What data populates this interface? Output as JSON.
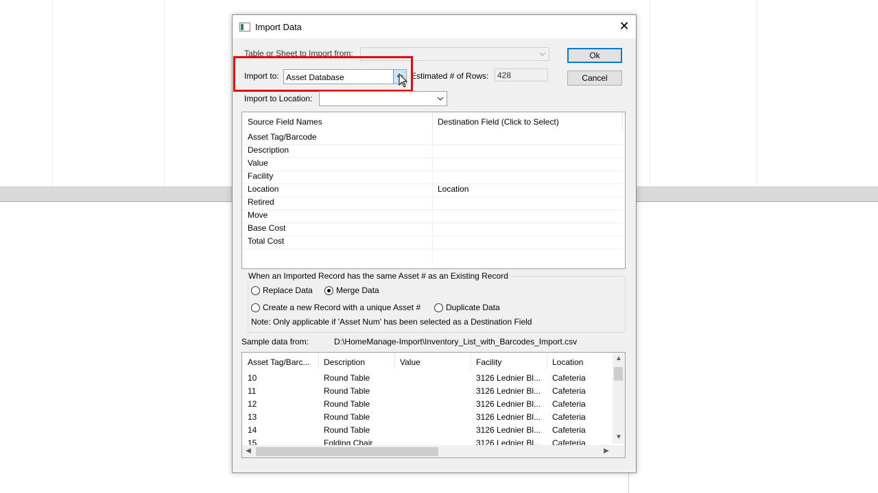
{
  "dialog": {
    "title": "Import Data",
    "close_glyph": "✕",
    "ok_label": "Ok",
    "cancel_label": "Cancel"
  },
  "form": {
    "table_label": "Table or Sheet to Import from:",
    "table_value": "",
    "import_to_label": "Import to:",
    "import_to_value": "Asset Database",
    "est_rows_label": "Estimated # of Rows:",
    "est_rows_value": "428",
    "location_label": "Import to Location:",
    "location_value": ""
  },
  "mapping": {
    "col_source": "Source Field Names",
    "col_dest": "Destination Field (Click to Select)",
    "rows": [
      {
        "src": "Asset Tag/Barcode",
        "dst": ""
      },
      {
        "src": "Description",
        "dst": ""
      },
      {
        "src": "Value",
        "dst": ""
      },
      {
        "src": "Facility",
        "dst": ""
      },
      {
        "src": "Location",
        "dst": "Location"
      },
      {
        "src": "Retired",
        "dst": ""
      },
      {
        "src": "Move",
        "dst": ""
      },
      {
        "src": "Base Cost",
        "dst": ""
      },
      {
        "src": "Total Cost",
        "dst": ""
      }
    ]
  },
  "duplicates": {
    "group_title": "When an Imported Record has the same Asset # as an Existing Record",
    "replace_label": "Replace Data",
    "merge_label": "Merge Data",
    "create_label": "Create a new Record with a unique Asset #",
    "duplicate_label": "Duplicate Data",
    "selected": "merge",
    "note": "Note:  Only applicable if 'Asset Num' has been selected as a Destination Field"
  },
  "sample": {
    "label": "Sample data from:",
    "path": "D:\\HomeManage-Import\\Inventory_List_with_Barcodes_Import.csv",
    "headers": [
      "Asset Tag/Barc...",
      "Description",
      "Value",
      "Facility",
      "Location"
    ],
    "rows": [
      [
        "10",
        "Round Table",
        "",
        "3126 Lednier Bl...",
        "Cafeteria"
      ],
      [
        "11",
        "Round Table",
        "",
        "3126 Lednier Bl...",
        "Cafeteria"
      ],
      [
        "12",
        "Round Table",
        "",
        "3126 Lednier Bl...",
        "Cafeteria"
      ],
      [
        "13",
        "Round Table",
        "",
        "3126 Lednier Bl...",
        "Cafeteria"
      ],
      [
        "14",
        "Round Table",
        "",
        "3126 Lednier Bl...",
        "Cafeteria"
      ],
      [
        "15",
        "Folding Chair",
        "",
        "3126 Lednier Bl...",
        "Cafeteria"
      ]
    ]
  }
}
